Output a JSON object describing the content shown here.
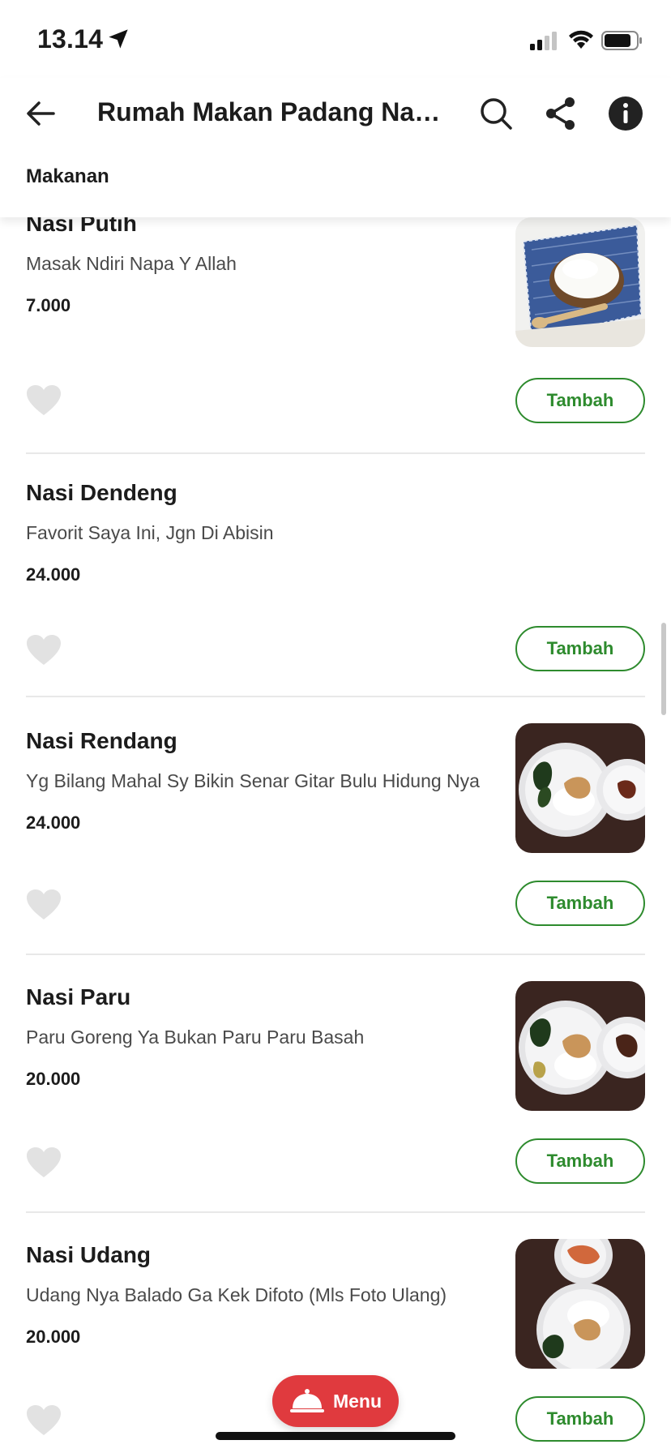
{
  "status": {
    "time": "13.14"
  },
  "header": {
    "title": "Rumah Makan Padang Nasi...",
    "section": "Makanan"
  },
  "colors": {
    "accent_green": "#2e8b2e",
    "brand_red": "#e03a3e",
    "divider": "#e8e8e8",
    "heart_grey": "#e0e0e0"
  },
  "items": [
    {
      "name": "Nasi Putih",
      "desc": "Masak Ndiri Napa Y Allah",
      "price": "7.000",
      "add_label": "Tambah",
      "photo": "white-rice-photo"
    },
    {
      "name": "Nasi Dendeng",
      "desc": "Favorit Saya Ini, Jgn Di Abisin",
      "price": "24.000",
      "add_label": "Tambah"
    },
    {
      "name": "Nasi Rendang",
      "desc": "Yg Bilang Mahal Sy Bikin Senar Gitar Bulu Hidung Nya",
      "price": "24.000",
      "add_label": "Tambah",
      "photo": "rendang-plate-photo"
    },
    {
      "name": "Nasi Paru",
      "desc": "Paru Goreng Ya Bukan Paru Paru Basah",
      "price": "20.000",
      "add_label": "Tambah",
      "photo": "paru-plate-photo"
    },
    {
      "name": "Nasi Udang",
      "desc": "Udang Nya Balado Ga Kek Difoto (Mls Foto Ulang)",
      "price": "20.000",
      "add_label": "Tambah",
      "photo": "udang-plate-photo"
    }
  ],
  "fab": {
    "label": "Menu",
    "icon": "cloche-icon"
  }
}
